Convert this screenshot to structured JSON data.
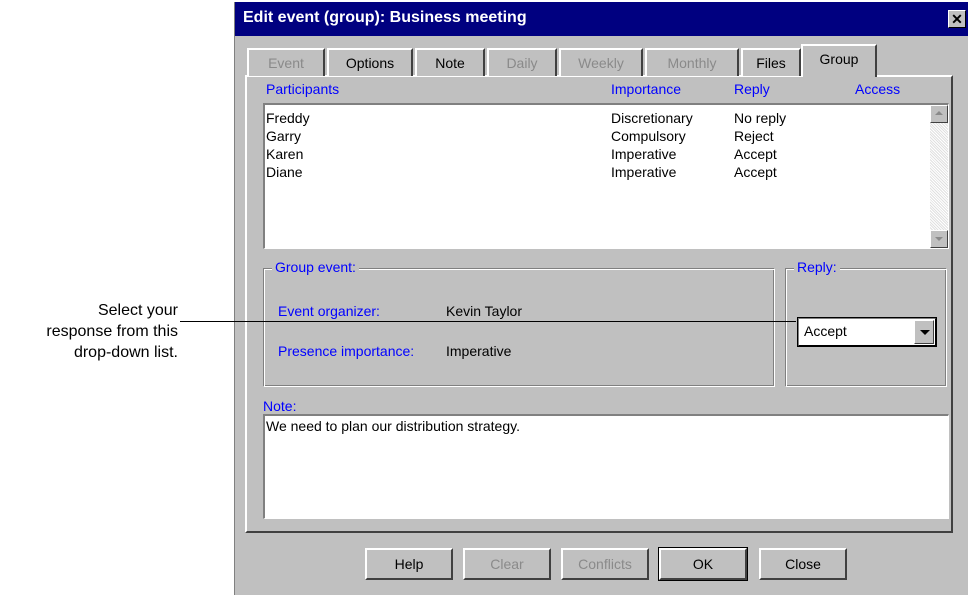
{
  "callout": {
    "lines": [
      "Select your",
      "response from this",
      "drop-down list."
    ]
  },
  "dialog": {
    "title": "Edit event (group): Business meeting",
    "close_glyph": "✕"
  },
  "tabs": [
    {
      "label": "Event",
      "disabled": true
    },
    {
      "label": "Options",
      "disabled": false
    },
    {
      "label": "Note",
      "disabled": false
    },
    {
      "label": "Daily",
      "disabled": true
    },
    {
      "label": "Weekly",
      "disabled": true
    },
    {
      "label": "Monthly",
      "disabled": true
    },
    {
      "label": "Files",
      "disabled": false
    },
    {
      "label": "Group",
      "disabled": false,
      "active": true
    }
  ],
  "participants": {
    "headers": {
      "participants": "Participants",
      "importance": "Importance",
      "reply": "Reply",
      "access": "Access"
    },
    "rows": [
      {
        "name": "Freddy",
        "importance": "Discretionary",
        "reply": "No reply"
      },
      {
        "name": "Garry",
        "importance": "Compulsory",
        "reply": "Reject"
      },
      {
        "name": "Karen",
        "importance": "Imperative",
        "reply": "Accept"
      },
      {
        "name": "Diane",
        "importance": "Imperative",
        "reply": "Accept"
      }
    ]
  },
  "group_event": {
    "legend": "Group event:",
    "organizer_label": "Event organizer:",
    "organizer_value": "Kevin Taylor",
    "presence_label": "Presence importance:",
    "presence_value": "Imperative"
  },
  "reply": {
    "legend": "Reply:",
    "selected": "Accept"
  },
  "note": {
    "label": "Note:",
    "text": "We need to plan our distribution strategy."
  },
  "buttons": {
    "help": "Help",
    "clear": "Clear",
    "conflicts": "Conflicts",
    "ok": "OK",
    "close": "Close"
  },
  "colors": {
    "titlebar": "#000080",
    "label_blue": "#0000ff",
    "face": "#c0c0c0"
  }
}
